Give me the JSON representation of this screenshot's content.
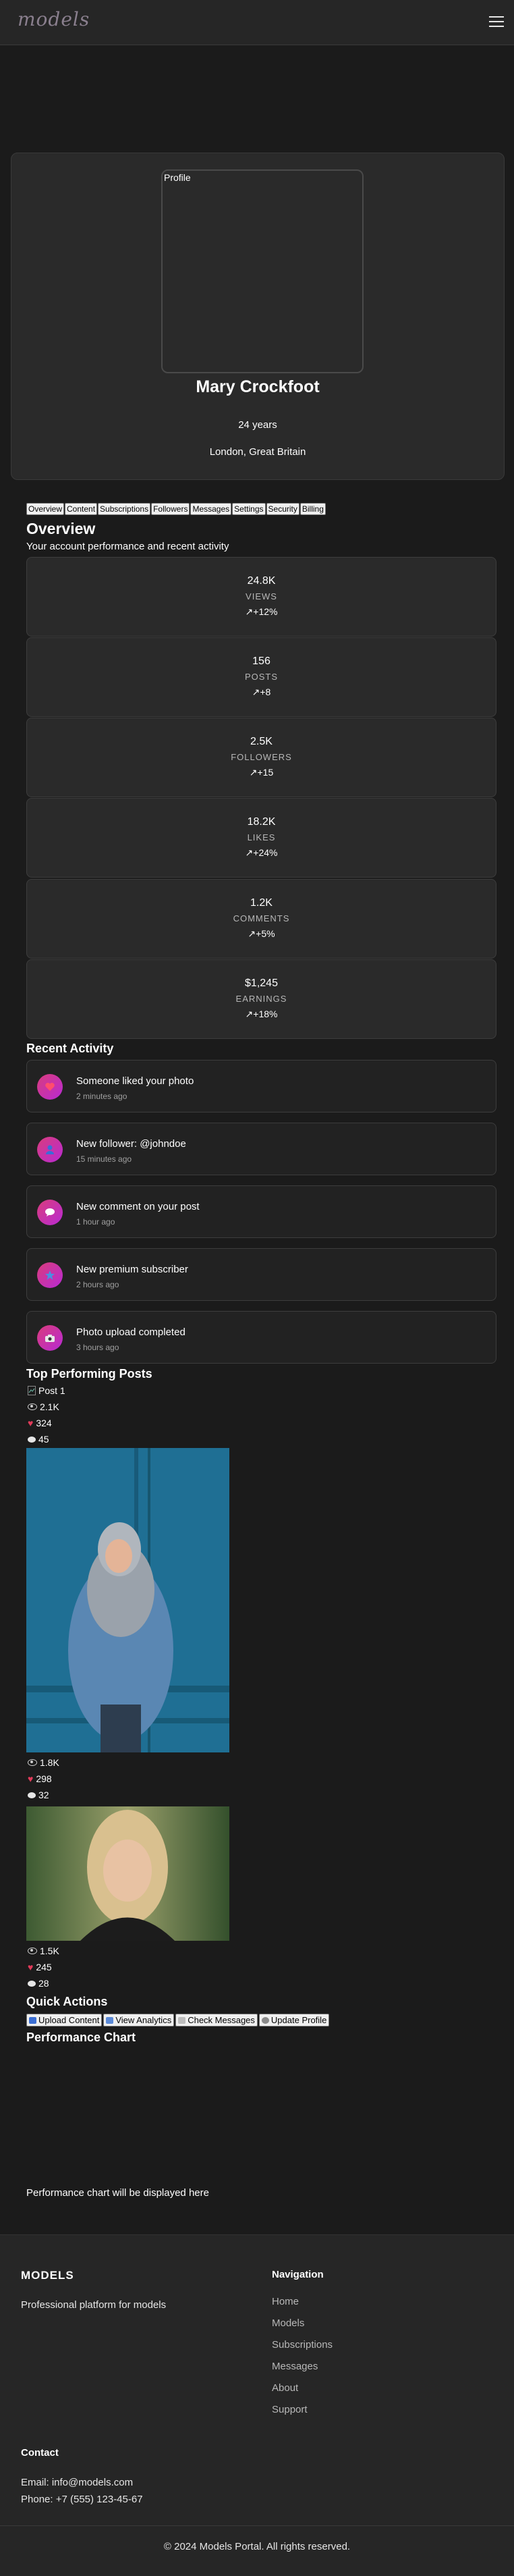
{
  "header": {
    "logo": "models",
    "menu_icon": "hamburger-menu-icon"
  },
  "profile": {
    "photo_alt": "Profile",
    "name": "Mary Crockfoot",
    "age": "24 years",
    "location": "London, Great Britain"
  },
  "tabs": [
    "Overview",
    "Content",
    "Subscriptions",
    "Followers",
    "Messages",
    "Settings",
    "Security",
    "Billing"
  ],
  "overview": {
    "title": "Overview",
    "subtitle": "Your account performance and recent activity",
    "stats": [
      {
        "value": "24.8K",
        "label": "VIEWS",
        "change": "↗+12%"
      },
      {
        "value": "156",
        "label": "POSTS",
        "change": "↗+8"
      },
      {
        "value": "2.5K",
        "label": "FOLLOWERS",
        "change": "↗+15"
      },
      {
        "value": "18.2K",
        "label": "LIKES",
        "change": "↗+24%"
      },
      {
        "value": "1.2K",
        "label": "COMMENTS",
        "change": "↗+5%"
      },
      {
        "value": "$1,245",
        "label": "EARNINGS",
        "change": "↗+18%"
      }
    ]
  },
  "recent_activity": {
    "title": "Recent Activity",
    "items": [
      {
        "text": "Someone liked your photo",
        "time": "2 minutes ago",
        "icon": "heart-icon"
      },
      {
        "text": "New follower: @johndoe",
        "time": "15 minutes ago",
        "icon": "user-icon"
      },
      {
        "text": "New comment on your post",
        "time": "1 hour ago",
        "icon": "comment-icon"
      },
      {
        "text": "New premium subscriber",
        "time": "2 hours ago",
        "icon": "star-icon"
      },
      {
        "text": "Photo upload completed",
        "time": "3 hours ago",
        "icon": "camera-icon"
      }
    ]
  },
  "top_posts": {
    "title": "Top Performing Posts",
    "posts": [
      {
        "alt": "Post 1",
        "views": "2.1K",
        "likes": "324",
        "comments": "45"
      },
      {
        "views": "1.8K",
        "likes": "298",
        "comments": "32"
      },
      {
        "views": "1.5K",
        "likes": "245",
        "comments": "28"
      }
    ]
  },
  "quick_actions": {
    "title": "Quick Actions",
    "buttons": [
      {
        "label": "Upload Content",
        "icon": "upload-icon",
        "color": "#3b6fd4"
      },
      {
        "label": "View Analytics",
        "icon": "analytics-icon",
        "color": "#5b8ad8"
      },
      {
        "label": "Check Messages",
        "icon": "messages-icon",
        "color": "#bdbdbd"
      },
      {
        "label": "Update Profile",
        "icon": "settings-icon",
        "color": "#8a8a8a"
      }
    ]
  },
  "performance_chart": {
    "title": "Performance Chart",
    "placeholder": "Performance chart will be displayed here"
  },
  "footer": {
    "brand": "MODELS",
    "tagline": "Professional platform for models",
    "nav_title": "Navigation",
    "nav_links": [
      "Home",
      "Models",
      "Subscriptions",
      "Messages",
      "About",
      "Support"
    ],
    "contact_title": "Contact",
    "email": "Email: info@models.com",
    "phone": "Phone: +7 (555) 123-45-67",
    "copyright": "© 2024 Models Portal. All rights reserved."
  },
  "colors": {
    "background": "#1b1b1b",
    "card": "#2a2a2a",
    "accent_gradient_start": "#d93c7c",
    "accent_gradient_end": "#b82ad4"
  }
}
